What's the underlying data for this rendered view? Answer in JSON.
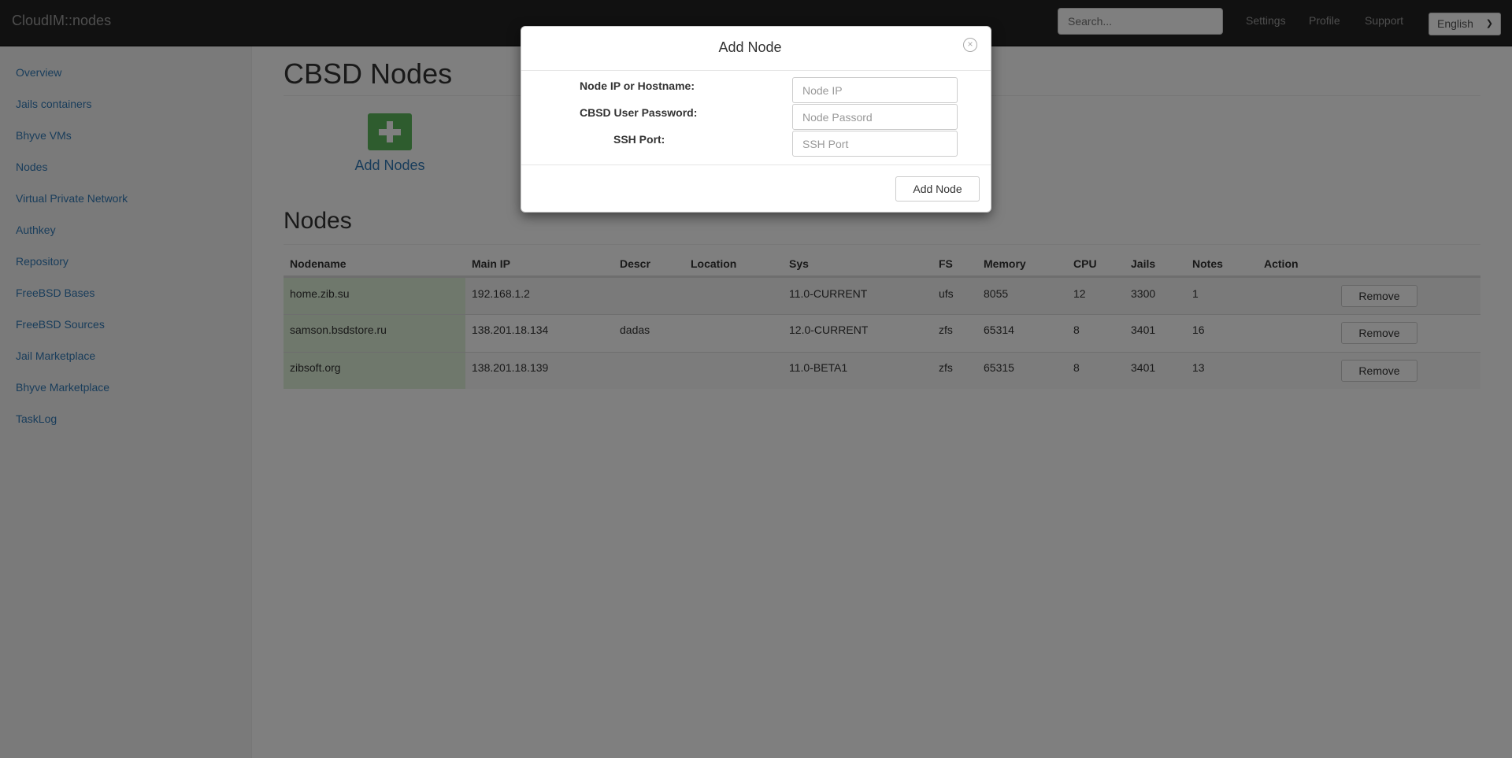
{
  "navbar": {
    "brand": "CloudIM::nodes",
    "search_placeholder": "Search...",
    "links": [
      "Settings",
      "Profile",
      "Support"
    ],
    "language": "English"
  },
  "sidebar": {
    "items": [
      "Overview",
      "Jails containers",
      "Bhyve VMs",
      "Nodes",
      "Virtual Private Network",
      "Authkey",
      "Repository",
      "FreeBSD Bases",
      "FreeBSD Sources",
      "Jail Marketplace",
      "Bhyve Marketplace",
      "TaskLog"
    ]
  },
  "main": {
    "title": "CBSD Nodes",
    "add_nodes_label": "Add Nodes",
    "nodes_title": "Nodes"
  },
  "table": {
    "columns": [
      "Nodename",
      "Main IP",
      "Descr",
      "Location",
      "Sys",
      "FS",
      "Memory",
      "CPU",
      "Jails",
      "Notes",
      "Action"
    ],
    "rows": [
      {
        "nodename": "home.zib.su",
        "main_ip": "192.168.1.2",
        "descr": "",
        "location": "",
        "sys": "11.0-CURRENT",
        "fs": "ufs",
        "memory": "8055",
        "cpu": "12",
        "jails": "3300",
        "notes": "1",
        "action": "Remove"
      },
      {
        "nodename": "samson.bsdstore.ru",
        "main_ip": "138.201.18.134",
        "descr": "dadas",
        "location": "",
        "sys": "12.0-CURRENT",
        "fs": "zfs",
        "memory": "65314",
        "cpu": "8",
        "jails": "3401",
        "notes": "16",
        "action": "Remove"
      },
      {
        "nodename": "zibsoft.org",
        "main_ip": "138.201.18.139",
        "descr": "",
        "location": "",
        "sys": "11.0-BETA1",
        "fs": "zfs",
        "memory": "65315",
        "cpu": "8",
        "jails": "3401",
        "notes": "13",
        "action": "Remove"
      }
    ]
  },
  "modal": {
    "title": "Add Node",
    "close_symbol": "×",
    "fields": [
      {
        "label": "Node IP or Hostname:",
        "placeholder": "Node IP"
      },
      {
        "label": "CBSD User Password:",
        "placeholder": "Node Passord"
      },
      {
        "label": "SSH Port:",
        "placeholder": "SSH Port"
      }
    ],
    "submit_label": "Add Node"
  },
  "colors": {
    "navbar_bg": "#222222",
    "link": "#337ab7",
    "success_cell": "#dff0d8",
    "add_icon": "#5cb85c",
    "hover_row": "#f5f5f5"
  }
}
